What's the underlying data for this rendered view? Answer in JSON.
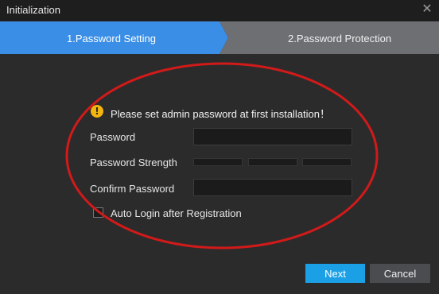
{
  "window": {
    "title": "Initialization",
    "close_icon": "close-icon"
  },
  "steps": [
    {
      "label": "1.Password Setting",
      "state": "active"
    },
    {
      "label": "2.Password Protection",
      "state": "inactive"
    }
  ],
  "notice": {
    "icon": "warning-icon",
    "text": "Please set admin password at first installation！"
  },
  "form": {
    "password_label": "Password",
    "password_value": "",
    "strength_label": "Password Strength",
    "strength_level": 0,
    "confirm_label": "Confirm Password",
    "confirm_value": "",
    "auto_login_label": "Auto Login after Registration",
    "auto_login_checked": false
  },
  "buttons": {
    "next": "Next",
    "cancel": "Cancel"
  },
  "colors": {
    "active_step": "#3a8ee6",
    "inactive_step": "#6d6f73",
    "primary_button": "#1ba0e6",
    "annotation_ellipse": "#d11a1a",
    "warning": "#f5b50f"
  }
}
